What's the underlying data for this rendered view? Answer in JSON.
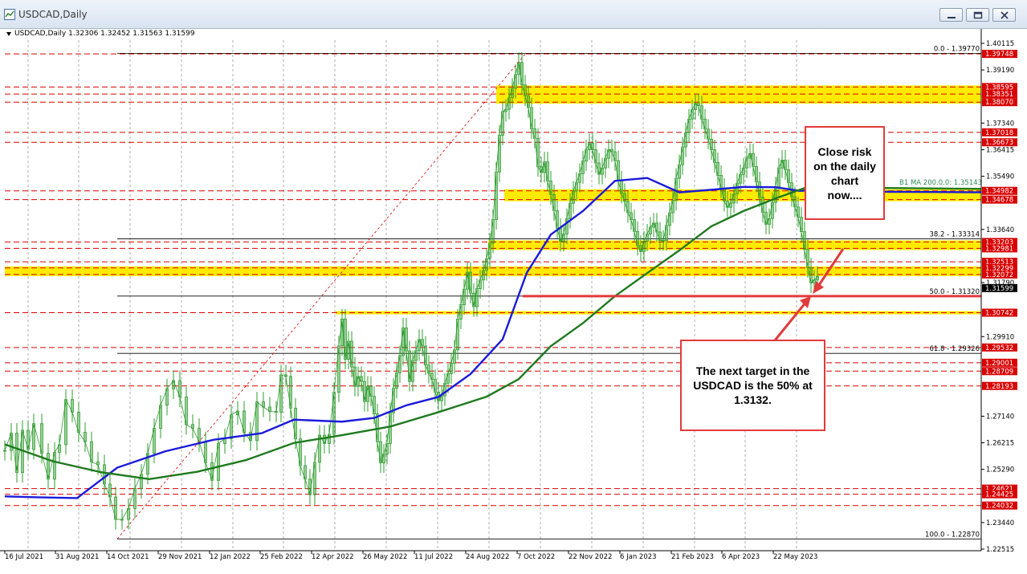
{
  "window": {
    "title": "USDCAD,Daily",
    "minimize_label": "minimize",
    "restore_label": "restore",
    "close_label": "close"
  },
  "header": {
    "symbol_line": "USDCAD,Daily  1.32306 1.32452 1.31563 1.31599"
  },
  "annotations": {
    "close_risk": "Close risk\non the daily\nchart\nnow....",
    "next_target": "The next target in the\nUSDCAD is the 50% at\n1.3132."
  },
  "colors": {
    "fib_line": "#000000",
    "red_level": "#d80000",
    "yellow_zone": "#ffea00",
    "ma100": "#1a1adb",
    "ma200": "#1f7a1f",
    "candle": "#2e9c2e",
    "annotation_border": "#e23b3b"
  },
  "chart_data": {
    "type": "line",
    "symbol": "USDCAD",
    "timeframe": "Daily",
    "ohlc_last": {
      "open": 1.32306,
      "high": 1.32452,
      "low": 1.31563,
      "close": 1.31599
    },
    "current_price": 1.31599,
    "ylim": [
      1.2225,
      1.4045
    ],
    "grid": true,
    "x_tick_labels": [
      "16 Jul 2021",
      "31 Aug 2021",
      "14 Oct 2021",
      "29 Nov 2021",
      "12 Jan 2022",
      "25 Feb 2022",
      "12 Apr 2022",
      "26 May 2022",
      "11 Jul 2022",
      "24 Aug 2022",
      "7 Oct 2022",
      "22 Nov 2022",
      "6 Jan 2023",
      "21 Feb 2023",
      "6 Apr 2023",
      "22 May 2023"
    ],
    "y_tick_labels": [
      1.40115,
      1.3919,
      1.3734,
      1.36415,
      1.3549,
      1.3364,
      1.3179,
      1.2991,
      1.2714,
      1.26215,
      1.2529,
      1.2344,
      1.22515
    ],
    "fibonacci": [
      {
        "label": "0.0 - 1.39770",
        "value": 1.3977
      },
      {
        "label": "38.2 - 1.33314",
        "value": 1.33314
      },
      {
        "label": "50.0 - 1.31320",
        "value": 1.3132
      },
      {
        "label": "61.8 - 1.29326",
        "value": 1.29326
      },
      {
        "label": "100.0 - 1.22870",
        "value": 1.2287
      }
    ],
    "price_levels": [
      1.39748,
      1.38595,
      1.38351,
      1.3807,
      1.37018,
      1.36673,
      1.34982,
      1.34678,
      1.33203,
      1.32981,
      1.32513,
      1.32299,
      1.32072,
      1.30742,
      1.29532,
      1.29001,
      1.28709,
      1.28193,
      1.24621,
      1.24425,
      1.24032
    ],
    "yellow_zones": [
      {
        "from": 1.3807,
        "to": 1.38595
      },
      {
        "from": 1.34678,
        "to": 1.34982
      },
      {
        "from": 1.32981,
        "to": 1.33203
      },
      {
        "from": 1.32072,
        "to": 1.32299
      }
    ],
    "ma_label": "B1 MA 200.0.0: 1.35143",
    "series": [
      {
        "name": "close",
        "x": [
          0,
          8,
          15,
          22,
          29,
          36,
          46,
          54,
          62,
          68,
          76,
          84,
          92,
          100,
          108,
          116,
          124,
          131,
          138,
          146,
          154,
          162,
          170,
          178,
          186,
          194,
          202,
          210,
          218,
          226,
          234,
          242,
          250,
          258,
          266,
          274,
          282,
          290,
          298,
          306,
          314,
          322,
          330,
          338,
          344,
          350,
          356,
          362,
          368,
          374,
          380,
          386,
          392,
          398,
          404,
          410,
          416,
          420,
          424,
          428,
          432,
          436,
          440,
          444,
          448,
          452,
          456,
          460,
          464,
          468,
          472,
          476,
          480,
          484,
          488,
          492,
          496,
          500,
          504,
          508,
          512,
          516,
          520,
          524,
          528,
          532,
          536,
          540,
          544,
          548,
          552,
          556,
          560,
          564,
          568,
          572,
          576,
          580,
          584,
          588,
          592,
          596,
          600,
          604,
          608,
          612,
          616,
          620,
          624,
          628,
          632,
          636,
          640,
          644,
          648,
          652,
          656,
          660,
          664,
          668,
          672,
          676,
          680,
          684,
          688,
          692,
          696,
          700,
          704,
          708,
          712,
          716,
          720,
          724,
          728,
          732,
          736,
          740,
          744,
          748,
          752,
          756,
          760,
          764,
          768,
          772,
          776,
          780,
          784,
          788,
          792,
          796,
          800,
          804,
          808,
          812,
          816,
          820,
          824,
          828,
          832,
          836,
          840,
          844,
          848,
          852,
          856,
          860,
          864,
          868,
          872,
          876,
          880,
          884,
          888,
          892,
          896,
          900,
          904,
          908,
          912,
          916,
          920,
          924,
          928,
          932,
          936,
          940,
          944,
          948,
          952,
          956,
          960,
          964,
          968,
          972,
          976,
          980,
          984,
          988,
          992,
          996,
          1000,
          1004,
          1008,
          1012
        ],
        "values": [
          1.2595,
          1.2655,
          1.2518,
          1.2665,
          1.2598,
          1.2688,
          1.2585,
          1.2495,
          1.2588,
          1.2615,
          1.2772,
          1.2728,
          1.2658,
          1.2625,
          1.2555,
          1.2545,
          1.2478,
          1.2433,
          1.2355,
          1.2355,
          1.2393,
          1.2463,
          1.2512,
          1.2585,
          1.2672,
          1.2752,
          1.2809,
          1.2838,
          1.2781,
          1.2685,
          1.2672,
          1.2625,
          1.2552,
          1.2491,
          1.2619,
          1.2636,
          1.2719,
          1.2732,
          1.2658,
          1.2629,
          1.2764,
          1.2746,
          1.2731,
          1.2728,
          1.2858,
          1.2852,
          1.2742,
          1.2635,
          1.2542,
          1.2495,
          1.2441,
          1.2554,
          1.2648,
          1.2619,
          1.2651,
          1.2797,
          1.2959,
          1.3052,
          1.2912,
          1.2975,
          1.2885,
          1.2818,
          1.2852,
          1.2835,
          1.2765,
          1.2818,
          1.2783,
          1.2722,
          1.2625,
          1.2552,
          1.2582,
          1.2619,
          1.2726,
          1.2811,
          1.2865,
          1.2925,
          1.3021,
          1.2941,
          1.2835,
          1.2908,
          1.2942,
          1.2981,
          1.2958,
          1.2892,
          1.2863,
          1.2842,
          1.2798,
          1.2768,
          1.2785,
          1.2829,
          1.2862,
          1.2898,
          1.2945,
          1.3052,
          1.3102,
          1.3156,
          1.3215,
          1.3142,
          1.3095,
          1.3158,
          1.3188,
          1.3221,
          1.3262,
          1.3316,
          1.3398,
          1.3564,
          1.3692,
          1.3774,
          1.3782,
          1.3822,
          1.3855,
          1.3903,
          1.3945,
          1.3867,
          1.3829,
          1.3788,
          1.3714,
          1.3681,
          1.3582,
          1.3562,
          1.3599,
          1.3532,
          1.3485,
          1.3429,
          1.3368,
          1.3322,
          1.3348,
          1.3402,
          1.3455,
          1.3498,
          1.3528,
          1.3558,
          1.3602,
          1.3641,
          1.3663,
          1.3641,
          1.3595,
          1.3556,
          1.3578,
          1.3612,
          1.3642,
          1.3634,
          1.3603,
          1.3533,
          1.3489,
          1.3461,
          1.3422,
          1.3398,
          1.3357,
          1.3308,
          1.3287,
          1.3323,
          1.3348,
          1.3372,
          1.3386,
          1.3355,
          1.3326,
          1.3325,
          1.3378,
          1.3422,
          1.3465,
          1.3542,
          1.3589,
          1.3651,
          1.3701,
          1.3748,
          1.3781,
          1.3802,
          1.3794,
          1.3748,
          1.3713,
          1.3678,
          1.3641,
          1.3597,
          1.3552,
          1.3508,
          1.3462,
          1.3441,
          1.3456,
          1.3488,
          1.3525,
          1.3555,
          1.3578,
          1.3612,
          1.3628,
          1.3583,
          1.3529,
          1.3476,
          1.3423,
          1.3382,
          1.3402,
          1.3458,
          1.3512,
          1.3578,
          1.3605,
          1.3572,
          1.3526,
          1.3478,
          1.3442,
          1.3406,
          1.3356,
          1.3294,
          1.3231,
          1.3178,
          1.3188,
          1.3201
        ]
      },
      {
        "name": "ma100",
        "x": [
          0,
          40,
          90,
          140,
          200,
          260,
          320,
          360,
          420,
          460,
          500,
          540,
          580,
          620,
          650,
          680,
          720,
          760,
          800,
          840,
          880,
          920,
          960,
          990,
          1010,
          1100,
          1220
        ],
        "values": [
          1.2435,
          1.2432,
          1.2429,
          1.2535,
          1.2592,
          1.2632,
          1.2655,
          1.2702,
          1.2695,
          1.2708,
          1.2752,
          1.2781,
          1.2861,
          1.2982,
          1.3213,
          1.3346,
          1.3428,
          1.3533,
          1.3543,
          1.3493,
          1.3502,
          1.3512,
          1.3511,
          1.3498,
          1.3502,
          1.3495,
          1.3493
        ]
      },
      {
        "name": "ma200",
        "x": [
          0,
          60,
          120,
          180,
          240,
          300,
          360,
          420,
          480,
          540,
          600,
          640,
          680,
          720,
          760,
          800,
          840,
          880,
          920,
          960,
          1000,
          1100,
          1220
        ],
        "values": [
          1.2616,
          1.2557,
          1.2519,
          1.2495,
          1.2521,
          1.2561,
          1.2621,
          1.2648,
          1.2678,
          1.2728,
          1.2782,
          1.2843,
          1.2958,
          1.3038,
          1.3132,
          1.3212,
          1.3291,
          1.3375,
          1.3428,
          1.3472,
          1.3512,
          1.3508,
          1.3505
        ]
      }
    ]
  }
}
